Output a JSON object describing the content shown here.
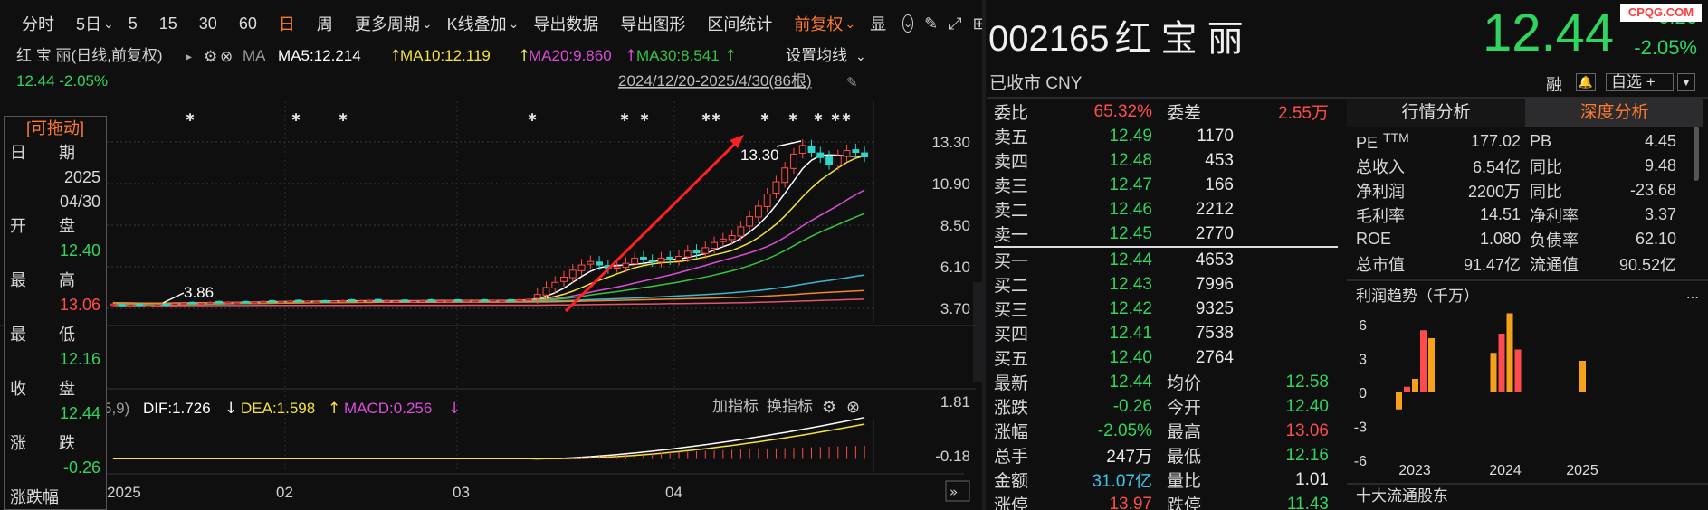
{
  "toolbar": {
    "items": [
      {
        "label": "分时",
        "active": false
      },
      {
        "label": "5日",
        "active": false,
        "dropdown": true
      },
      {
        "label": "5",
        "active": false
      },
      {
        "label": "15",
        "active": false
      },
      {
        "label": "30",
        "active": false
      },
      {
        "label": "60",
        "active": false
      },
      {
        "label": "日",
        "active": true
      },
      {
        "label": "周",
        "active": false
      },
      {
        "label": "更多周期",
        "active": false,
        "dropdown": true
      },
      {
        "label": "K线叠加",
        "active": false,
        "dropdown": true
      },
      {
        "label": "导出数据",
        "active": false
      },
      {
        "label": "导出图形",
        "active": false
      },
      {
        "label": "区间统计",
        "active": false
      },
      {
        "label": "前复权",
        "active": true,
        "dropdown": true
      },
      {
        "label": "显",
        "active": false
      }
    ]
  },
  "chart_header": {
    "name": "红 宝 丽(日线,前复权)",
    "ma_label": "MA",
    "ma5": "MA5:12.214",
    "ma10": "MA10:12.119",
    "ma20": "MA20:9.860",
    "ma30": "MA30:8.541",
    "settings": "设置均线",
    "price_change": "12.44 -2.05%",
    "range": "2024/12/20-2025/4/30(86根)"
  },
  "colors": {
    "ma5": "#ffffff",
    "ma10": "#f2e33a",
    "ma20": "#d94dd9",
    "ma30": "#38c43e",
    "ma60": "#3cb7d4",
    "ma120": "#f0892a",
    "ma250": "#e05570",
    "up": "#ff4b4b",
    "down": "#2fd5c9",
    "accent": "#ff7a2e",
    "arrow": "#ff2020"
  },
  "tooltip_box": {
    "title": "[可拖动]",
    "date_label": "日　　期",
    "year": "2025",
    "date": "04/30",
    "open_label": "开　　盘",
    "open": "12.40",
    "high_label": "最　　高",
    "high": "13.06",
    "low_label": "最　　低",
    "low": "12.16",
    "close_label": "收　　盘",
    "close": "12.44",
    "change_label": "涨　　跌",
    "change": "-0.26",
    "amp_label": "涨跌幅"
  },
  "price_axis": [
    "13.30",
    "10.90",
    "8.50",
    "6.10",
    "3.70"
  ],
  "annotations": {
    "high": "13.30",
    "low": "3.86"
  },
  "macd": {
    "params": "5,9)",
    "dif": "DIF:1.726",
    "dea": "DEA:1.598",
    "macd": "MACD:0.256",
    "add_indicator": "加指标",
    "switch_indicator": "换指标",
    "axis": [
      "1.81",
      "-0.18"
    ]
  },
  "x_axis": [
    "2025",
    "02",
    "03",
    "04"
  ],
  "chart_data": {
    "type": "candlestick",
    "title": "红 宝 丽(日线,前复权)",
    "period": "2024/12/20-2025/4/30",
    "bars": 86,
    "ylim": [
      3.7,
      13.3
    ],
    "last_bar": {
      "date": "2025/04/30",
      "open": 12.4,
      "high": 13.06,
      "low": 12.16,
      "close": 12.44,
      "change": -0.26,
      "change_pct": -2.05
    },
    "closes": [
      3.95,
      3.92,
      3.9,
      3.88,
      3.86,
      3.9,
      3.94,
      3.98,
      4.0,
      4.02,
      4.0,
      4.05,
      4.04,
      4.06,
      4.05,
      4.08,
      4.06,
      4.1,
      4.08,
      4.1,
      4.12,
      4.1,
      4.12,
      4.1,
      4.14,
      4.12,
      4.15,
      4.13,
      4.14,
      4.16,
      4.12,
      4.15,
      4.13,
      4.14,
      4.12,
      4.15,
      4.16,
      4.14,
      4.15,
      4.13,
      4.16,
      4.15,
      4.14,
      4.17,
      4.15,
      4.18,
      4.2,
      4.22,
      4.5,
      4.9,
      5.2,
      5.5,
      5.9,
      6.2,
      6.4,
      6.2,
      6.0,
      6.1,
      6.3,
      6.6,
      6.5,
      6.4,
      6.6,
      6.5,
      6.7,
      7.0,
      6.9,
      7.2,
      7.5,
      7.7,
      7.9,
      8.4,
      9.0,
      9.6,
      10.3,
      11.0,
      11.8,
      12.6,
      13.1,
      12.7,
      12.4,
      12.0,
      12.5,
      12.8,
      12.7,
      12.44
    ],
    "ma": {
      "MA5": 12.214,
      "MA10": 12.119,
      "MA20": 9.86,
      "MA30": 8.541
    },
    "macd": {
      "DIF": 1.726,
      "DEA": 1.598,
      "MACD": 0.256
    }
  },
  "quote": {
    "code": "002165",
    "name": "红 宝 丽",
    "status": "已收市 CNY",
    "price": "12.44",
    "change": "-0.26",
    "change_pct": "-2.05%",
    "badge": "融",
    "favorite": "自选 +",
    "watermark": "CPQG.COM"
  },
  "order_book": {
    "weibi_label": "委比",
    "weibi": "65.32%",
    "weicha_label": "委差",
    "weicha": "2.55万",
    "asks": [
      {
        "label": "卖五",
        "price": "12.49",
        "vol": "1170"
      },
      {
        "label": "卖四",
        "price": "12.48",
        "vol": "453"
      },
      {
        "label": "卖三",
        "price": "12.47",
        "vol": "166"
      },
      {
        "label": "卖二",
        "price": "12.46",
        "vol": "2212"
      },
      {
        "label": "卖一",
        "price": "12.45",
        "vol": "2770"
      }
    ],
    "bids": [
      {
        "label": "买一",
        "price": "12.44",
        "vol": "4653"
      },
      {
        "label": "买二",
        "price": "12.43",
        "vol": "7996"
      },
      {
        "label": "买三",
        "price": "12.42",
        "vol": "9325"
      },
      {
        "label": "买四",
        "price": "12.41",
        "vol": "7538"
      },
      {
        "label": "买五",
        "price": "12.40",
        "vol": "2764"
      }
    ]
  },
  "stats": [
    {
      "l1": "最新",
      "v1": "12.44",
      "c1": "green",
      "l2": "均价",
      "v2": "12.58",
      "c2": "green"
    },
    {
      "l1": "涨跌",
      "v1": "-0.26",
      "c1": "green",
      "l2": "今开",
      "v2": "12.40",
      "c2": "green"
    },
    {
      "l1": "涨幅",
      "v1": "-2.05%",
      "c1": "green",
      "l2": "最高",
      "v2": "13.06",
      "c2": "red"
    },
    {
      "l1": "总手",
      "v1": "247万",
      "c1": "white",
      "l2": "最低",
      "v2": "12.16",
      "c2": "green"
    },
    {
      "l1": "金额",
      "v1": "31.07亿",
      "c1": "cyan",
      "l2": "量比",
      "v2": "1.01",
      "c2": "white"
    },
    {
      "l1": "涨停",
      "v1": "13.97",
      "c1": "red",
      "l2": "跌停",
      "v2": "11.43",
      "c2": "green"
    }
  ],
  "analysis": {
    "tab1": "行情分析",
    "tab2": "深度分析",
    "rows": [
      {
        "l1": "PE",
        "l1b": "TTM",
        "v1": "177.02",
        "l2": "PB",
        "v2": "4.45"
      },
      {
        "l1": "总收入",
        "l1b": "",
        "v1": "6.54亿",
        "l2": "同比",
        "v2": "9.48"
      },
      {
        "l1": "净利润",
        "l1b": "",
        "v1": "2200万",
        "l2": "同比",
        "v2": "-23.68"
      },
      {
        "l1": "毛利率",
        "l1b": "",
        "v1": "14.51",
        "l2": "净利率",
        "v2": "3.37"
      },
      {
        "l1": "ROE",
        "l1b": "",
        "v1": "1.080",
        "l2": "负债率",
        "v2": "62.10"
      },
      {
        "l1": "总市值",
        "l1b": "",
        "v1": "91.47亿",
        "l2": "流通值",
        "v2": "90.52亿"
      }
    ],
    "profit_title": "利润趋势（千万）",
    "more": "...",
    "profit_axis": [
      "6",
      "3",
      "0",
      "-3",
      "-6"
    ],
    "profit_years": [
      "2023",
      "2024",
      "2025"
    ],
    "holders_title": "十大流通股东"
  },
  "profit_chart": {
    "type": "bar",
    "unit": "千万",
    "ylim": [
      -6,
      6
    ],
    "groups": [
      {
        "year": "2023",
        "values": [
          -1.5,
          0.5,
          1.2,
          5.5,
          4.8
        ]
      },
      {
        "year": "2024",
        "values": [
          3.5,
          5.2,
          7.0,
          3.8
        ]
      },
      {
        "year": "2025",
        "values": [
          2.8
        ]
      }
    ]
  }
}
